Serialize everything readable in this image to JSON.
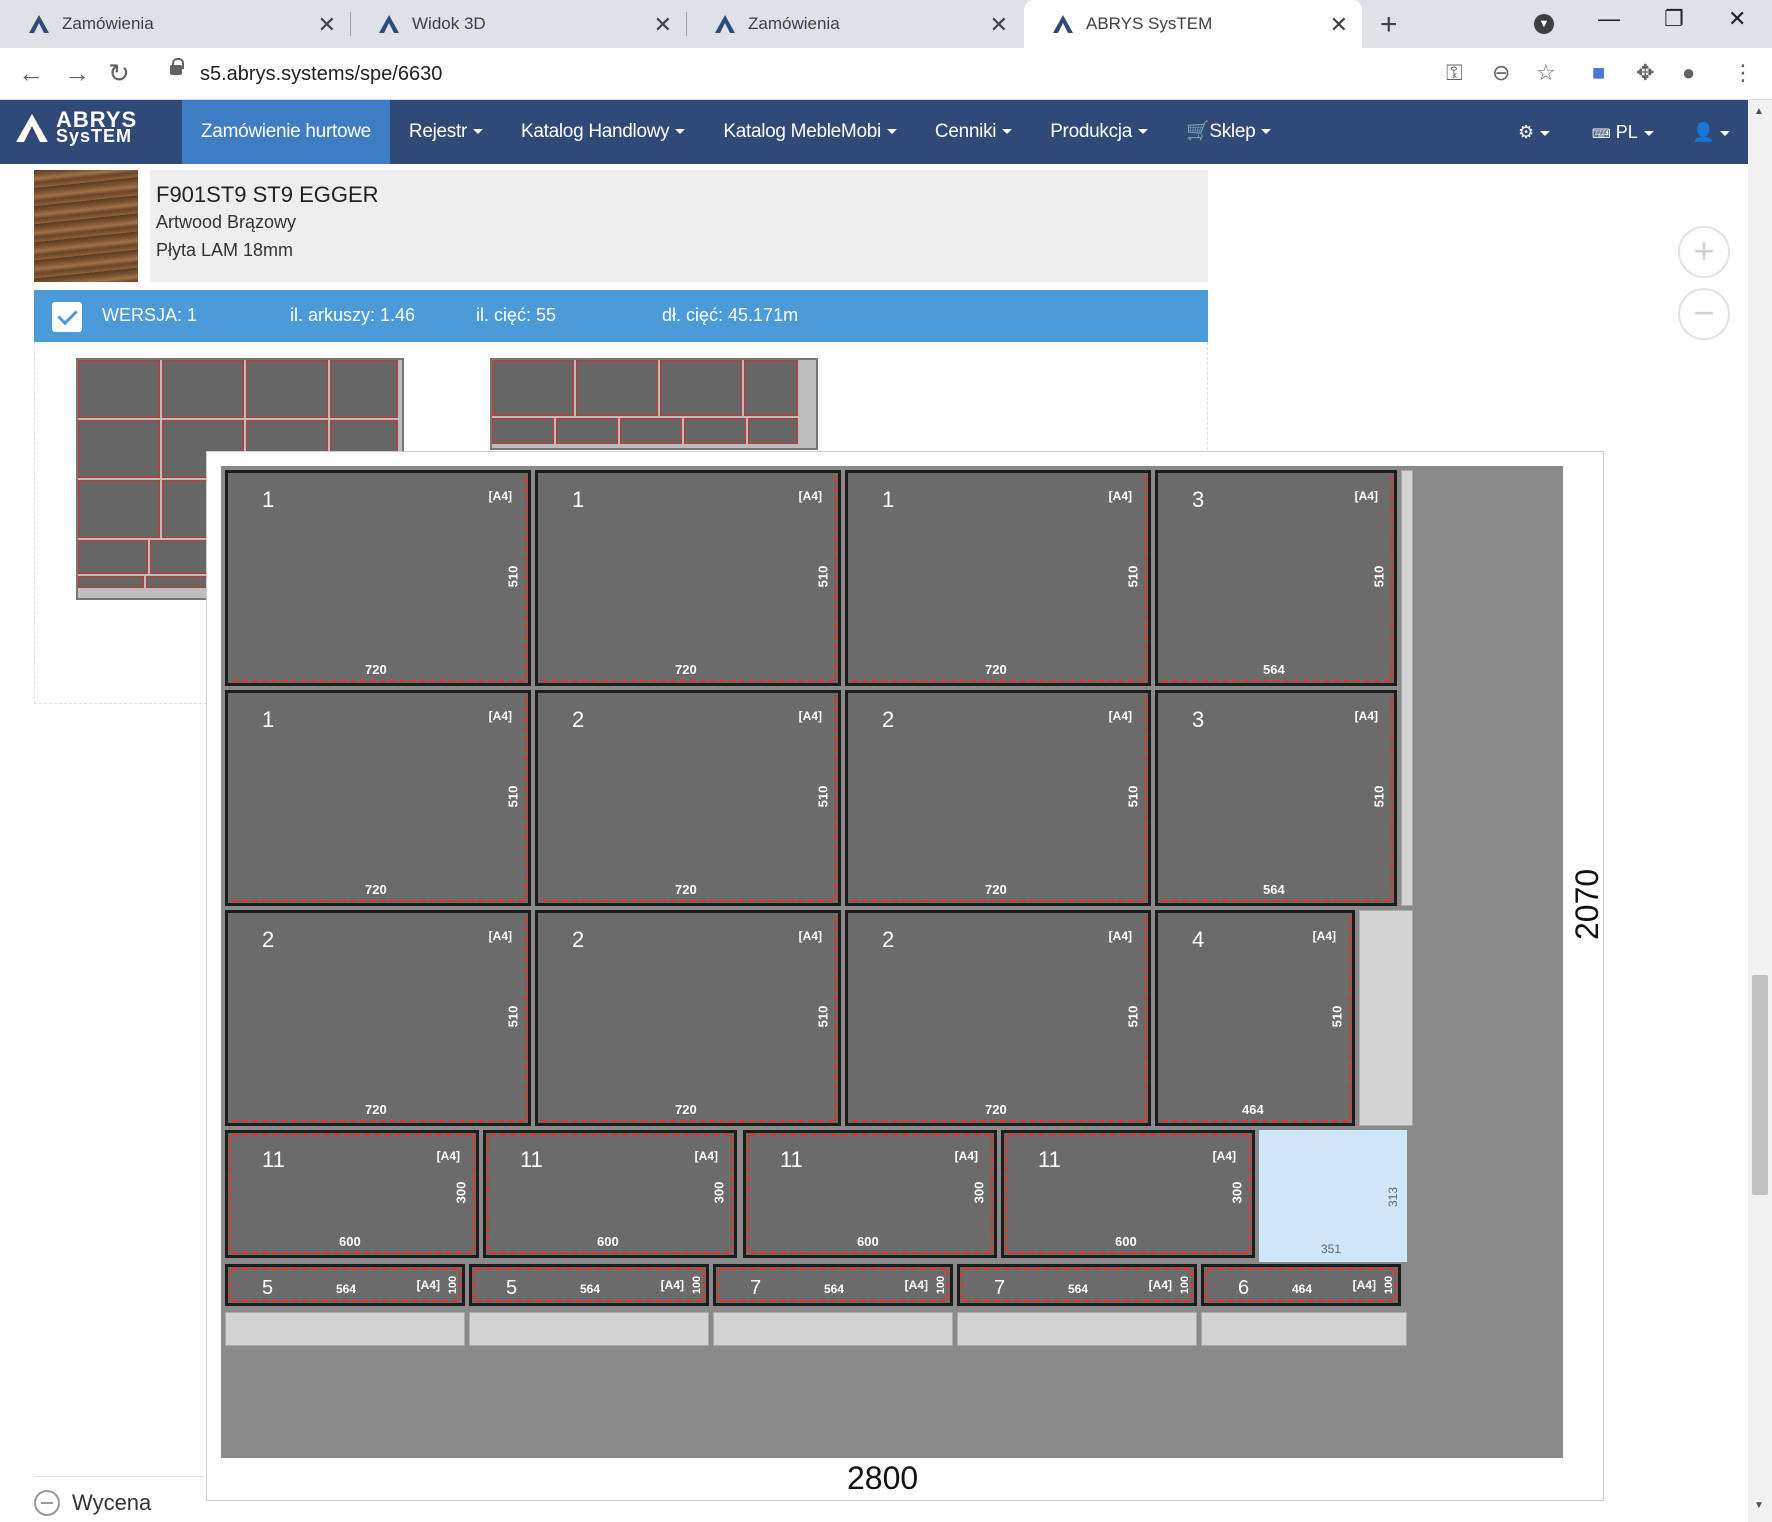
{
  "browser": {
    "tabs": [
      {
        "title": "Zamówienia",
        "active": false
      },
      {
        "title": "Widok 3D",
        "active": false
      },
      {
        "title": "Zamówienia",
        "active": false
      },
      {
        "title": "ABRYS SysTEM",
        "active": true
      }
    ],
    "url": "s5.abrys.systems/spe/6630"
  },
  "app": {
    "brand_line1": "ABRYS",
    "brand_line2": "SysTEM",
    "menu": [
      {
        "label": "Zamówienie hurtowe",
        "active": true,
        "dropdown": false
      },
      {
        "label": "Rejestr",
        "active": false,
        "dropdown": true
      },
      {
        "label": "Katalog Handlowy",
        "active": false,
        "dropdown": true
      },
      {
        "label": "Katalog MebleMobi",
        "active": false,
        "dropdown": true
      },
      {
        "label": "Cenniki",
        "active": false,
        "dropdown": true
      },
      {
        "label": "Produkcja",
        "active": false,
        "dropdown": true
      },
      {
        "label": "Sklep",
        "active": false,
        "dropdown": true
      }
    ],
    "lang": "PL"
  },
  "material": {
    "code": "F901ST9 ST9 EGGER",
    "name": "Artwood Brązowy",
    "type": "Płyta LAM 18mm"
  },
  "version_bar": {
    "version": "WERSJA: 1",
    "sheets": "il. arkuszy: 1.46",
    "cuts": "il. cięć: 55",
    "cut_length": "dł. cięć: 45.171m"
  },
  "diagram": {
    "sheet_width": "2800",
    "sheet_height": "2070",
    "edge_code": "[A4]",
    "offcut": {
      "w": "351",
      "h": "313"
    },
    "rows": [
      [
        {
          "n": "1",
          "w": "720",
          "h": "510"
        },
        {
          "n": "1",
          "w": "720",
          "h": "510"
        },
        {
          "n": "1",
          "w": "720",
          "h": "510"
        },
        {
          "n": "3",
          "w": "564",
          "h": "510"
        }
      ],
      [
        {
          "n": "1",
          "w": "720",
          "h": "510"
        },
        {
          "n": "2",
          "w": "720",
          "h": "510"
        },
        {
          "n": "2",
          "w": "720",
          "h": "510"
        },
        {
          "n": "3",
          "w": "564",
          "h": "510"
        }
      ],
      [
        {
          "n": "2",
          "w": "720",
          "h": "510"
        },
        {
          "n": "2",
          "w": "720",
          "h": "510"
        },
        {
          "n": "2",
          "w": "720",
          "h": "510"
        },
        {
          "n": "4",
          "w": "464",
          "h": "510"
        }
      ],
      [
        {
          "n": "11",
          "w": "600",
          "h": "300"
        },
        {
          "n": "11",
          "w": "600",
          "h": "300"
        },
        {
          "n": "11",
          "w": "600",
          "h": "300"
        },
        {
          "n": "11",
          "w": "600",
          "h": "300"
        }
      ],
      [
        {
          "n": "5",
          "w": "564",
          "h": "100"
        },
        {
          "n": "5",
          "w": "564",
          "h": "100"
        },
        {
          "n": "7",
          "w": "564",
          "h": "100"
        },
        {
          "n": "7",
          "w": "564",
          "h": "100"
        },
        {
          "n": "6",
          "w": "464",
          "h": "100"
        }
      ]
    ]
  },
  "section": {
    "wycena": "Wycena"
  }
}
